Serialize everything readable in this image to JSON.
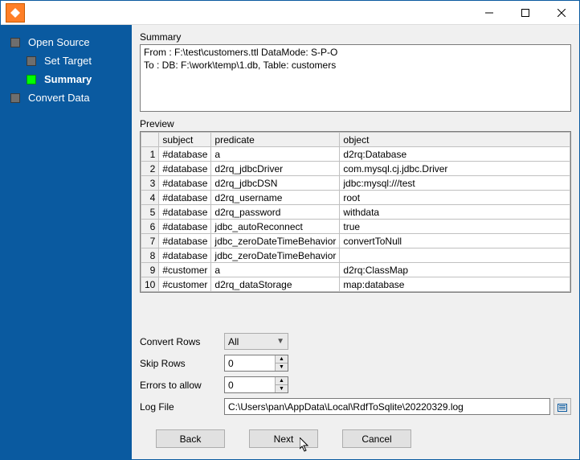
{
  "sidebar": {
    "items": [
      {
        "label": "Open Source"
      },
      {
        "label": "Set Target"
      },
      {
        "label": "Summary"
      },
      {
        "label": "Convert Data"
      }
    ]
  },
  "summary": {
    "title": "Summary",
    "line1": "From : F:\\test\\customers.ttl DataMode: S-P-O",
    "line2": "To : DB: F:\\work\\temp\\1.db, Table: customers"
  },
  "preview": {
    "title": "Preview",
    "columns": [
      "subject",
      "predicate",
      "object"
    ],
    "rows": [
      {
        "n": "1",
        "subject": "#database",
        "predicate": "a",
        "object": "d2rq:Database"
      },
      {
        "n": "2",
        "subject": "#database",
        "predicate": "d2rq_jdbcDriver",
        "object": "com.mysql.cj.jdbc.Driver"
      },
      {
        "n": "3",
        "subject": "#database",
        "predicate": "d2rq_jdbcDSN",
        "object": "jdbc:mysql:///test"
      },
      {
        "n": "4",
        "subject": "#database",
        "predicate": "d2rq_username",
        "object": "root"
      },
      {
        "n": "5",
        "subject": "#database",
        "predicate": "d2rq_password",
        "object": "withdata"
      },
      {
        "n": "6",
        "subject": "#database",
        "predicate": "jdbc_autoReconnect",
        "object": "true"
      },
      {
        "n": "7",
        "subject": "#database",
        "predicate": "jdbc_zeroDateTimeBehavior",
        "object": "convertToNull"
      },
      {
        "n": "8",
        "subject": "#database",
        "predicate": "jdbc_zeroDateTimeBehavior",
        "object": ""
      },
      {
        "n": "9",
        "subject": "#customer",
        "predicate": "a",
        "object": "d2rq:ClassMap"
      },
      {
        "n": "10",
        "subject": "#customer",
        "predicate": "d2rq_dataStorage",
        "object": "map:database"
      }
    ]
  },
  "options": {
    "convert_rows_label": "Convert Rows",
    "convert_rows_value": "All",
    "skip_rows_label": "Skip Rows",
    "skip_rows_value": "0",
    "errors_label": "Errors to allow",
    "errors_value": "0",
    "log_label": "Log File",
    "log_value": "C:\\Users\\pan\\AppData\\Local\\RdfToSqlite\\20220329.log"
  },
  "buttons": {
    "back": "Back",
    "next": "Next",
    "cancel": "Cancel"
  }
}
